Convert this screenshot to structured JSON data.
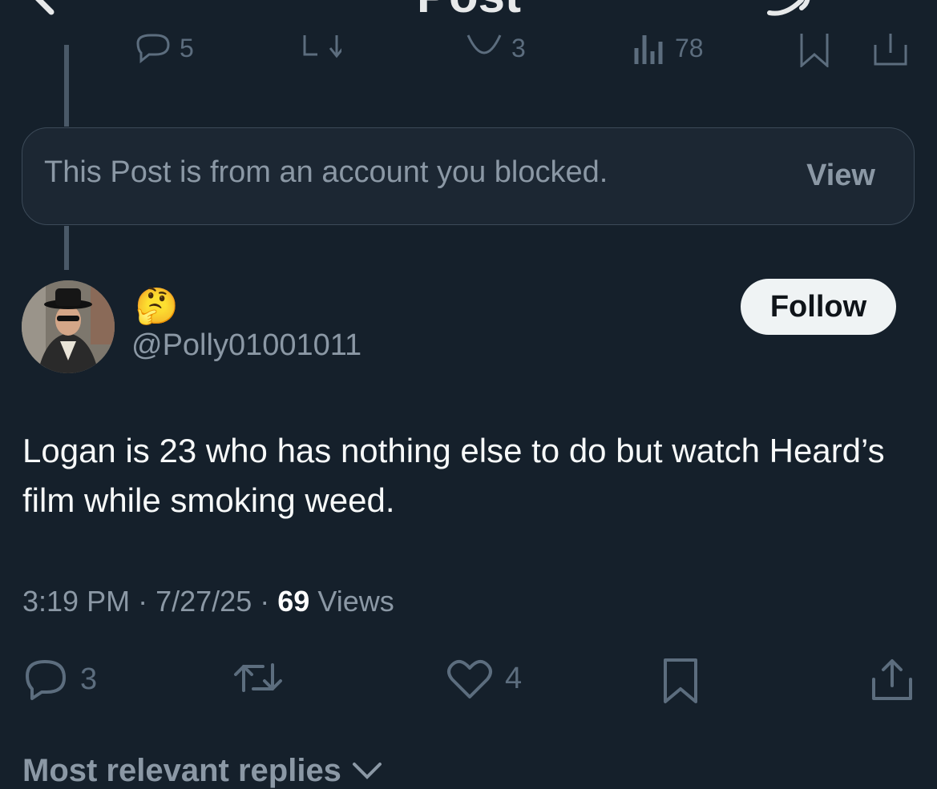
{
  "header": {
    "title": "Post"
  },
  "parent_actions": {
    "replies": "5",
    "likes": "3",
    "views": "78"
  },
  "blocked_notice": {
    "text": "This Post is from an account you blocked.",
    "view_label": "View"
  },
  "author": {
    "display_name": "🤔",
    "handle": "@Polly01001011",
    "follow_label": "Follow"
  },
  "post": {
    "text": "Logan is 23 who has nothing else to do but watch Heard’s film while smoking weed."
  },
  "meta": {
    "time": "3:19 PM",
    "separator": "·",
    "date": "7/27/25",
    "views_count": "69",
    "views_label": "Views"
  },
  "actions": {
    "replies": "3",
    "likes": "4"
  },
  "replies_section": {
    "label": "Most relevant replies"
  },
  "colors": {
    "background": "#15202b",
    "muted": "#8b98a5",
    "follow_bg": "#eff3f4"
  }
}
